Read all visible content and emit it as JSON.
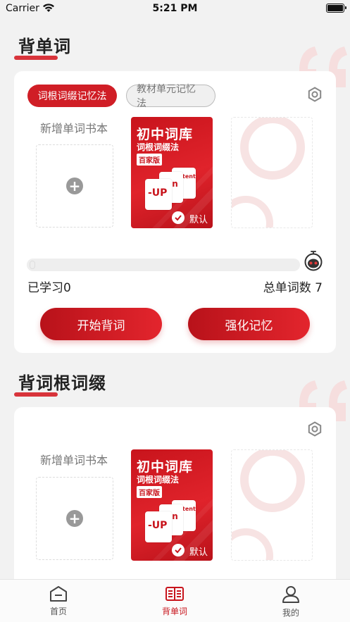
{
  "status_bar": {
    "carrier": "Carrier",
    "time": "5:21 PM"
  },
  "section1": {
    "title": "背单词",
    "tabs": [
      {
        "label": "词根词缀记忆法",
        "active": true
      },
      {
        "label": "教材单元记忆法",
        "active": false
      }
    ],
    "new_book_label": "新增单词书本",
    "book": {
      "title": "初中词库",
      "subtitle": "词根词缀法",
      "edition": "百家版",
      "tile_up": "-UP",
      "tile_on": "on",
      "tile_tent": "tent",
      "default_label": "默认"
    },
    "progress_value": 0,
    "learned": "已学习0",
    "total": "总单词数 7",
    "start_button": "开始背词",
    "reinforce_button": "强化记忆"
  },
  "section2": {
    "title": "背词根词缀",
    "new_book_label": "新增单词书本",
    "book": {
      "title": "初中词库",
      "subtitle": "词根词缀法",
      "edition": "百家版",
      "tile_up": "-UP",
      "tile_on": "on",
      "tile_tent": "tent",
      "default_label": "默认"
    }
  },
  "tab_bar": {
    "items": [
      {
        "label": "首页",
        "icon": "home-icon",
        "active": false
      },
      {
        "label": "背单词",
        "icon": "book-icon",
        "active": true
      },
      {
        "label": "我的",
        "icon": "profile-icon",
        "active": false
      }
    ]
  },
  "colors": {
    "accent": "#d01e26",
    "background": "#f2f2f2",
    "card": "#ffffff"
  }
}
